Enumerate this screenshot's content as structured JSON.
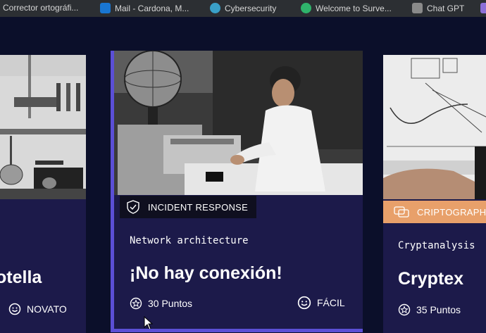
{
  "bookmarks": [
    {
      "label": "Corrector ortográfi...",
      "icon": "spellcheck-icon",
      "color": "#4a90e2"
    },
    {
      "label": "Mail - Cardona, M...",
      "icon": "outlook-icon",
      "color": "#1976d2"
    },
    {
      "label": "Cybersecurity",
      "icon": "cybersecurity-icon",
      "color": "#3aa0c8"
    },
    {
      "label": "Welcome to Surve...",
      "icon": "survey-icon",
      "color": "#2fb36b"
    },
    {
      "label": "Chat GPT",
      "icon": "chatgpt-icon",
      "color": "#8a8a8a"
    }
  ],
  "cards": {
    "left": {
      "title_fragment": "otella",
      "level": "NOVATO"
    },
    "center": {
      "category": "INCIDENT RESPONSE",
      "subtitle": "Network architecture",
      "title": "¡No hay conexión!",
      "points": "30 Puntos",
      "level": "FÁCIL"
    },
    "right": {
      "category": "CRIPTOGRAPHY",
      "subtitle": "Cryptanalysis",
      "title": "Cryptex",
      "points": "35 Puntos"
    }
  },
  "colors": {
    "background": "#0b0f2a",
    "card": "#1c1a4a",
    "accent": "#5b4fd6",
    "crypto_badge": "#e8a06a"
  }
}
